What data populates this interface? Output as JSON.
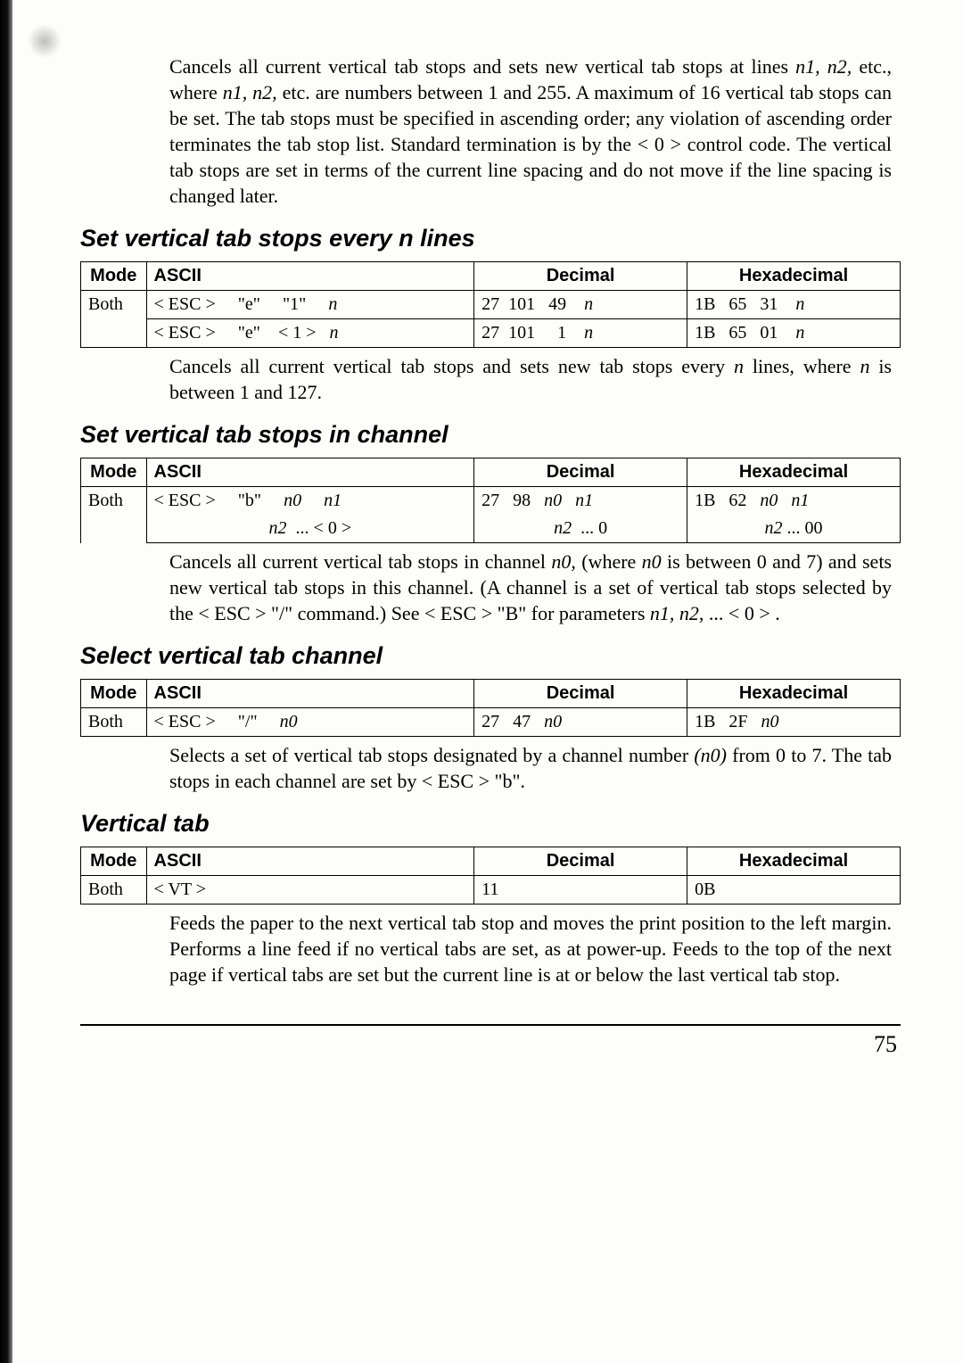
{
  "intro_para": "Cancels all current vertical tab stops and sets new vertical tab stops at lines n1, n2, etc., where n1, n2, etc. are numbers between 1 and 255. A maximum of 16 vertical tab stops can be set. The tab stops must be specified in ascending order; any violation of ascending order terminates the tab stop list. Standard termination is by the < 0 > control code. The vertical tab stops are set in terms of the current line spacing and do not move if the line spacing is changed later.",
  "h1": "Set vertical tab stops every n lines",
  "table1": {
    "headers": {
      "mode": "Mode",
      "ascii": "ASCII",
      "dec": "Decimal",
      "hex": "Hexadecimal"
    },
    "mode": "Both",
    "rows": [
      {
        "ascii": "< ESC >    \"e\"    \"1\"    n",
        "dec": "27  101   49    n",
        "hex": "1B   65   31    n"
      },
      {
        "ascii": "< ESC >    \"e\"    < 1 >   n",
        "dec": "27  101     1    n",
        "hex": "1B   65   01    n"
      }
    ]
  },
  "para1": "Cancels all current vertical tab stops and sets new tab stops every n lines, where n is between 1 and 127.",
  "h2": "Set vertical tab stops in channel",
  "table2": {
    "headers": {
      "mode": "Mode",
      "ascii": "ASCII",
      "dec": "Decimal",
      "hex": "Hexadecimal"
    },
    "mode": "Both",
    "row1": {
      "ascii": "< ESC >     \"b\"     n0     n1",
      "dec": "27   98   n0   n1",
      "hex": "1B   62   n0   n1"
    },
    "row2": {
      "ascii": "n2   ... < 0 >",
      "dec": "n2  ... 0",
      "hex": "n2 ... 00"
    }
  },
  "para2": "Cancels all current vertical tab stops in channel n0, (where n0 is between 0 and 7) and sets new vertical tab stops in this channel. (A channel is a set of vertical tab stops selected by the < ESC > \"/\" command.) See < ESC > \"B\" for parameters n1, n2, ... < 0 > .",
  "h3": "Select vertical tab channel",
  "table3": {
    "headers": {
      "mode": "Mode",
      "ascii": "ASCII",
      "dec": "Decimal",
      "hex": "Hexadecimal"
    },
    "mode": "Both",
    "row": {
      "ascii": "< ESC >     \"/\"     n0",
      "dec": "27   47   n0",
      "hex": "1B   2F   n0"
    }
  },
  "para3": "Selects a set of vertical tab stops designated by a channel number (n0) from 0 to 7. The tab stops in each channel are set by < ESC > \"b\".",
  "h4": "Vertical tab",
  "table4": {
    "headers": {
      "mode": "Mode",
      "ascii": "ASCII",
      "dec": "Decimal",
      "hex": "Hexadecimal"
    },
    "mode": "Both",
    "row": {
      "ascii": "< VT >",
      "dec": "11",
      "hex": "0B"
    }
  },
  "para4": "Feeds the paper to the next vertical tab stop and moves the print position to the left margin. Performs a line feed if no vertical tabs are set, as at power-up. Feeds to the top of the next page if vertical tabs are set but the current line is at or below the last vertical tab stop.",
  "page_number": "75"
}
